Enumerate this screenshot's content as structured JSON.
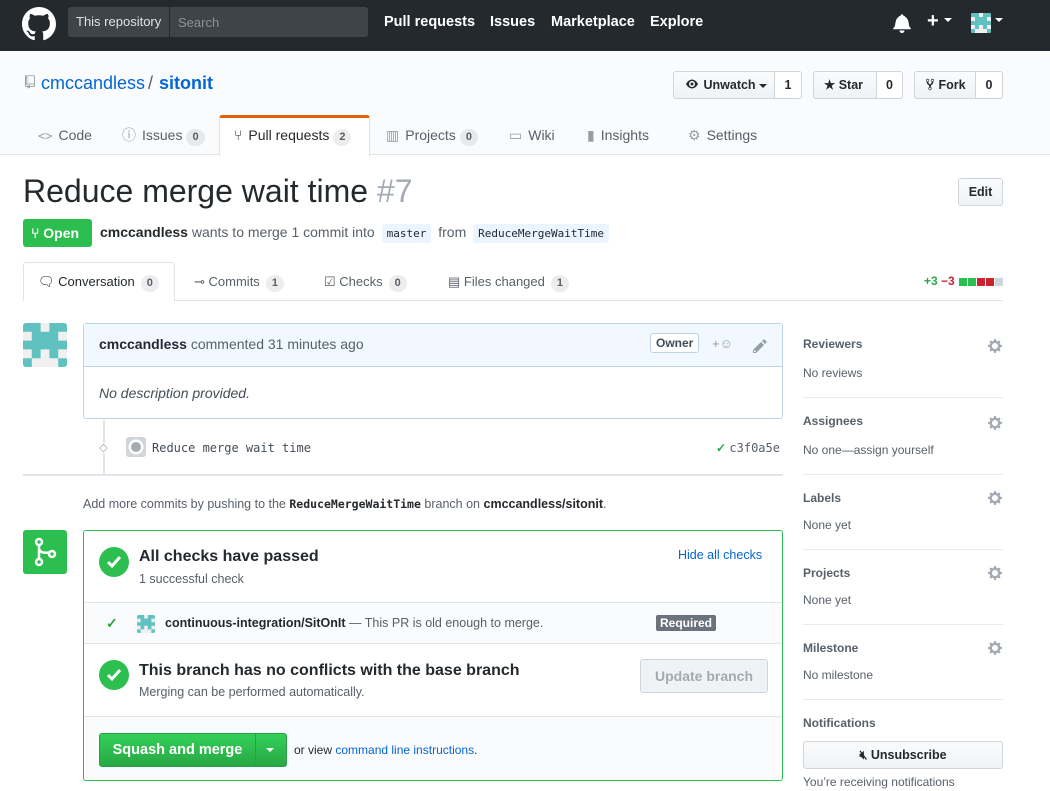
{
  "header": {
    "scope_label": "This repository",
    "search_placeholder": "Search",
    "nav": [
      "Pull requests",
      "Issues",
      "Marketplace",
      "Explore"
    ]
  },
  "repo": {
    "owner": "cmccandless",
    "slash": "/",
    "name": "sitonit",
    "unwatch_label": "Unwatch",
    "watch_count": "1",
    "star_label": "Star",
    "star_count": "0",
    "fork_label": "Fork",
    "fork_count": "0",
    "tabs": [
      {
        "label": "Code",
        "count": ""
      },
      {
        "label": "Issues",
        "count": "0"
      },
      {
        "label": "Pull requests",
        "count": "2"
      },
      {
        "label": "Projects",
        "count": "0"
      },
      {
        "label": "Wiki",
        "count": ""
      },
      {
        "label": "Insights",
        "count": ""
      },
      {
        "label": "Settings",
        "count": ""
      }
    ]
  },
  "pr": {
    "title": "Reduce merge wait time",
    "number": "#7",
    "edit_label": "Edit",
    "state": "Open",
    "author": "cmccandless",
    "meta_text": "wants to merge 1 commit into",
    "base": "master",
    "from_text": "from",
    "head": "ReduceMergeWaitTime",
    "tabs": [
      {
        "label": "Conversation",
        "count": "0"
      },
      {
        "label": "Commits",
        "count": "1"
      },
      {
        "label": "Checks",
        "count": "0"
      },
      {
        "label": "Files changed",
        "count": "1"
      }
    ],
    "additions": "+3",
    "deletions": "−3"
  },
  "comment": {
    "author": "cmccandless",
    "action": "commented 31 minutes ago",
    "role": "Owner",
    "body": "No description provided."
  },
  "commit": {
    "message": "Reduce merge wait time",
    "sha": "c3f0a5e"
  },
  "hint": {
    "prefix": "Add more commits by pushing to the",
    "branch": "ReduceMergeWaitTime",
    "middle": "branch on",
    "repo": "cmccandless/sitonit",
    "suffix": "."
  },
  "merge": {
    "checks_title": "All checks have passed",
    "checks_sub": "1 successful check",
    "hide_checks": "Hide all checks",
    "check_name": "continuous-integration/SitOnIt",
    "check_desc": "— This PR is old enough to merge.",
    "required": "Required",
    "conflict_title": "This branch has no conflicts with the base branch",
    "conflict_sub": "Merging can be performed automatically.",
    "update_branch": "Update branch",
    "squash_label": "Squash and merge",
    "or_view": "or view",
    "cli_link": "command line instructions",
    "period": "."
  },
  "sidebar": {
    "reviewers": {
      "h": "Reviewers",
      "v": "No reviews"
    },
    "assignees": {
      "h": "Assignees",
      "v": "No one—assign yourself"
    },
    "labels": {
      "h": "Labels",
      "v": "None yet"
    },
    "projects": {
      "h": "Projects",
      "v": "None yet"
    },
    "milestone": {
      "h": "Milestone",
      "v": "No milestone"
    },
    "notifications": {
      "h": "Notifications",
      "unsubscribe": "Unsubscribe",
      "v": "You’re receiving notifications"
    }
  },
  "colors": {
    "header_bg": "#24292e",
    "green": "#2cbe4e",
    "link": "#0366d6",
    "tab_accent": "#e36209",
    "diff_red": "#cb2431"
  }
}
